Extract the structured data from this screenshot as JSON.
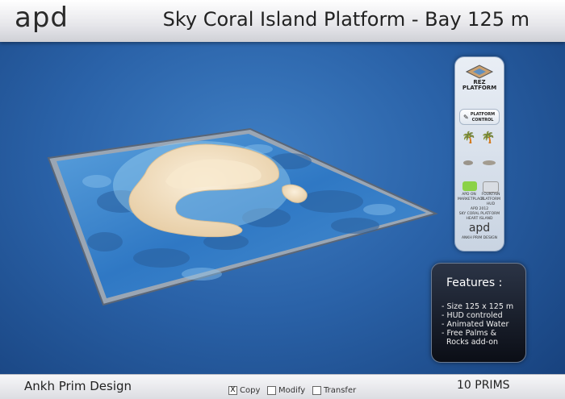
{
  "header": {
    "logo": "apd",
    "title": "Sky Coral Island Platform - Bay  125 m"
  },
  "panel": {
    "rez_label": "REZ\nPLATFORM",
    "rez_line1": "REZ",
    "rez_line2": "PLATFORM",
    "control_line1": "PLATFORM",
    "control_line2": "CONTROL",
    "market_label": "APD ON MARKETPLACE",
    "fountain_label": "FOUNTAIN PLATFORM HUD",
    "info_line1": "APD 2012",
    "info_line2": "SKY CORAL PLATFORM",
    "info_line3": "HEART ISLAND",
    "small_logo": "apd",
    "small_brand": "ANKH PRIM DESIGN"
  },
  "features": {
    "title": "Features :",
    "items": [
      "- Size  125 x 125 m",
      "- HUD controled",
      "- Animated Water",
      "- Free Palms &",
      "  Rocks add-on"
    ]
  },
  "footer": {
    "brand": "Ankh Prim Design",
    "prims": "10 PRIMS",
    "permissions": [
      {
        "label": "Copy",
        "checked": true,
        "mark": "X"
      },
      {
        "label": "Modify",
        "checked": false,
        "mark": ""
      },
      {
        "label": "Transfer",
        "checked": false,
        "mark": ""
      }
    ]
  }
}
